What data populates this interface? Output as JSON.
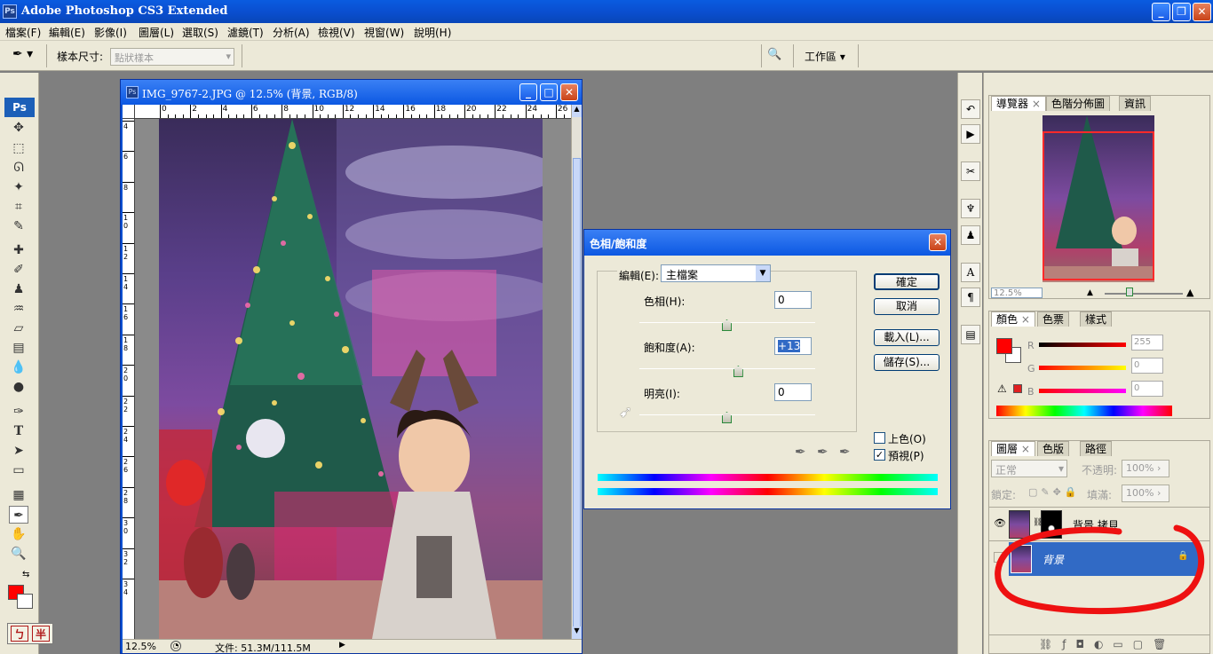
{
  "app": {
    "title": "Adobe Photoshop CS3 Extended",
    "icon": "Ps"
  },
  "menu": [
    "檔案(F)",
    "編輯(E)",
    "影像(I)",
    "圖層(L)",
    "選取(S)",
    "濾鏡(T)",
    "分析(A)",
    "檢視(V)",
    "視窗(W)",
    "說明(H)"
  ],
  "options": {
    "sample_label": "樣本尺寸:",
    "sample_value": "點狀樣本",
    "workspace": "工作區"
  },
  "document": {
    "title": "IMG_9767-2.JPG @ 12.5% (背景, RGB/8)",
    "zoom": "12.5%",
    "file_info": "文件: 51.3M/111.5M",
    "ruler_h": [
      "0",
      "2",
      "4",
      "6",
      "8",
      "10",
      "12",
      "14",
      "16",
      "18",
      "20",
      "22",
      "24",
      "26"
    ],
    "ruler_v": [
      "4",
      "6",
      "8",
      "10",
      "12",
      "14",
      "16",
      "18",
      "20",
      "22",
      "24",
      "26",
      "28",
      "30",
      "32",
      "34"
    ]
  },
  "dialog": {
    "title": "色相/飽和度",
    "edit_label": "編輯(E):",
    "edit_value": "主檔案",
    "hue_label": "色相(H):",
    "hue_value": "0",
    "hue_level": 0,
    "sat_label": "飽和度(A):",
    "sat_value": "+13",
    "sat_level": 13,
    "light_label": "明亮(I):",
    "light_value": "0",
    "light_level": 0,
    "ok": "確定",
    "cancel": "取消",
    "load": "載入(L)...",
    "save": "儲存(S)...",
    "colorize": "上色(O)",
    "preview": "預視(P)",
    "preview_checked": true
  },
  "navigator": {
    "tabs": [
      "導覽器",
      "色階分佈圖",
      "資訊"
    ],
    "zoom": "12.5%"
  },
  "color": {
    "tabs": [
      "顏色",
      "色票",
      "樣式"
    ],
    "r_label": "R",
    "g_label": "G",
    "b_label": "B",
    "r": "255",
    "g": "0",
    "b": "0",
    "foreground": "#ff0000"
  },
  "layers": {
    "tabs": [
      "圖層",
      "色版",
      "路徑"
    ],
    "blend": "正常",
    "opacity_label": "不透明:",
    "opacity": "100%",
    "lock_label": "鎖定:",
    "fill_label": "填滿:",
    "fill": "100%",
    "items": [
      {
        "name": "背景 拷貝",
        "selected": false
      },
      {
        "name": "背景",
        "selected": true
      }
    ]
  },
  "ime": [
    "ㄅ",
    "半"
  ]
}
